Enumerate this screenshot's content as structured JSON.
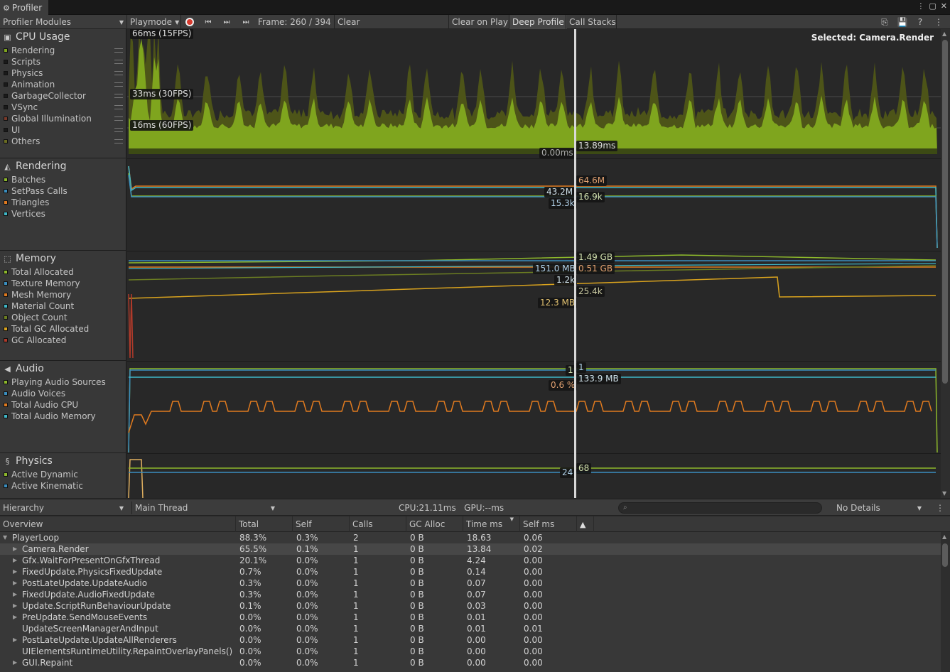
{
  "window": {
    "tab_title": "Profiler"
  },
  "toolbar": {
    "modules": "Profiler Modules",
    "playmode": "Playmode",
    "frame": "Frame: 260 / 394",
    "clear": "Clear",
    "clear_on_play": "Clear on Play",
    "deep_profile": "Deep Profile",
    "call_stacks": "Call Stacks"
  },
  "modules": [
    {
      "title": "CPU Usage",
      "icon": "cpu-icon",
      "items": [
        {
          "label": "Rendering",
          "color": "#7fa51e"
        },
        {
          "label": "Scripts",
          "color": "#1a1a1a"
        },
        {
          "label": "Physics",
          "color": "#1a1a1a"
        },
        {
          "label": "Animation",
          "color": "#1a1a1a"
        },
        {
          "label": "GarbageCollector",
          "color": "#1a1a1a"
        },
        {
          "label": "VSync",
          "color": "#1a1a1a"
        },
        {
          "label": "Global Illumination",
          "color": "#7a3a2a"
        },
        {
          "label": "UI",
          "color": "#1a1a1a"
        },
        {
          "label": "Others",
          "color": "#6b6d22"
        }
      ]
    },
    {
      "title": "Rendering",
      "icon": "rendering-icon",
      "items": [
        {
          "label": "Batches",
          "color": "#8db82b"
        },
        {
          "label": "SetPass Calls",
          "color": "#3a8ebf"
        },
        {
          "label": "Triangles",
          "color": "#e07a1f"
        },
        {
          "label": "Vertices",
          "color": "#3fb8c8"
        }
      ]
    },
    {
      "title": "Memory",
      "icon": "memory-icon",
      "items": [
        {
          "label": "Total Allocated",
          "color": "#8db82b"
        },
        {
          "label": "Texture Memory",
          "color": "#3a8ebf"
        },
        {
          "label": "Mesh Memory",
          "color": "#e07a1f"
        },
        {
          "label": "Material Count",
          "color": "#3fb8c8"
        },
        {
          "label": "Object Count",
          "color": "#6b7d22"
        },
        {
          "label": "Total GC Allocated",
          "color": "#d8a21e"
        },
        {
          "label": "GC Allocated",
          "color": "#b03a2a"
        }
      ]
    },
    {
      "title": "Audio",
      "icon": "audio-icon",
      "items": [
        {
          "label": "Playing Audio Sources",
          "color": "#8db82b"
        },
        {
          "label": "Audio Voices",
          "color": "#3a8ebf"
        },
        {
          "label": "Total Audio CPU",
          "color": "#e07a1f"
        },
        {
          "label": "Total Audio Memory",
          "color": "#3fb8c8"
        }
      ]
    },
    {
      "title": "Physics",
      "icon": "physics-icon",
      "items": [
        {
          "label": "Active Dynamic",
          "color": "#8db82b"
        },
        {
          "label": "Active Kinematic",
          "color": "#3a8ebf"
        }
      ]
    }
  ],
  "cpu_chart": {
    "selected": "Selected: Camera.Render",
    "fps_labels": [
      "66ms (15FPS)",
      "33ms (30FPS)",
      "16ms (60FPS)"
    ],
    "left_value": "0.00ms",
    "right_value": "13.89ms"
  },
  "render_chart": {
    "values": [
      "64.6M",
      "43.2M",
      "16.9k",
      "15.3k"
    ]
  },
  "memory_chart": {
    "values": [
      "1.49 GB",
      "151.0 MB",
      "0.51 GB",
      "1.2k",
      "25.4k",
      "12.3 MB"
    ]
  },
  "audio_chart": {
    "values": [
      "1",
      "1",
      "133.9 MB",
      "0.6 %"
    ]
  },
  "physics_chart": {
    "values": [
      "24",
      "68"
    ]
  },
  "bottom_toolbar": {
    "view": "Hierarchy",
    "thread": "Main Thread",
    "stats": "CPU:21.11ms   GPU:--ms",
    "details": "No Details"
  },
  "table": {
    "columns": [
      "Overview",
      "Total",
      "Self",
      "Calls",
      "GC Alloc",
      "Time ms",
      "Self ms"
    ],
    "rows": [
      [
        "PlayerLoop",
        "88.3%",
        "0.3%",
        "2",
        "0 B",
        "18.63",
        "0.06"
      ],
      [
        "Camera.Render",
        "65.5%",
        "0.1%",
        "1",
        "0 B",
        "13.84",
        "0.02"
      ],
      [
        "Gfx.WaitForPresentOnGfxThread",
        "20.1%",
        "0.0%",
        "1",
        "0 B",
        "4.24",
        "0.00"
      ],
      [
        "FixedUpdate.PhysicsFixedUpdate",
        "0.7%",
        "0.0%",
        "1",
        "0 B",
        "0.14",
        "0.00"
      ],
      [
        "PostLateUpdate.UpdateAudio",
        "0.3%",
        "0.0%",
        "1",
        "0 B",
        "0.07",
        "0.00"
      ],
      [
        "FixedUpdate.AudioFixedUpdate",
        "0.3%",
        "0.0%",
        "1",
        "0 B",
        "0.07",
        "0.00"
      ],
      [
        "Update.ScriptRunBehaviourUpdate",
        "0.1%",
        "0.0%",
        "1",
        "0 B",
        "0.03",
        "0.00"
      ],
      [
        "PreUpdate.SendMouseEvents",
        "0.0%",
        "0.0%",
        "1",
        "0 B",
        "0.01",
        "0.00"
      ],
      [
        "UpdateScreenManagerAndInput",
        "0.0%",
        "0.0%",
        "1",
        "0 B",
        "0.01",
        "0.01"
      ],
      [
        "PostLateUpdate.UpdateAllRenderers",
        "0.0%",
        "0.0%",
        "1",
        "0 B",
        "0.00",
        "0.00"
      ],
      [
        "UIElementsRuntimeUtility.RepaintOverlayPanels()",
        "0.0%",
        "0.0%",
        "1",
        "0 B",
        "0.00",
        "0.00"
      ],
      [
        "GUI.Repaint",
        "0.0%",
        "0.0%",
        "1",
        "0 B",
        "0.00",
        "0.00"
      ]
    ]
  }
}
